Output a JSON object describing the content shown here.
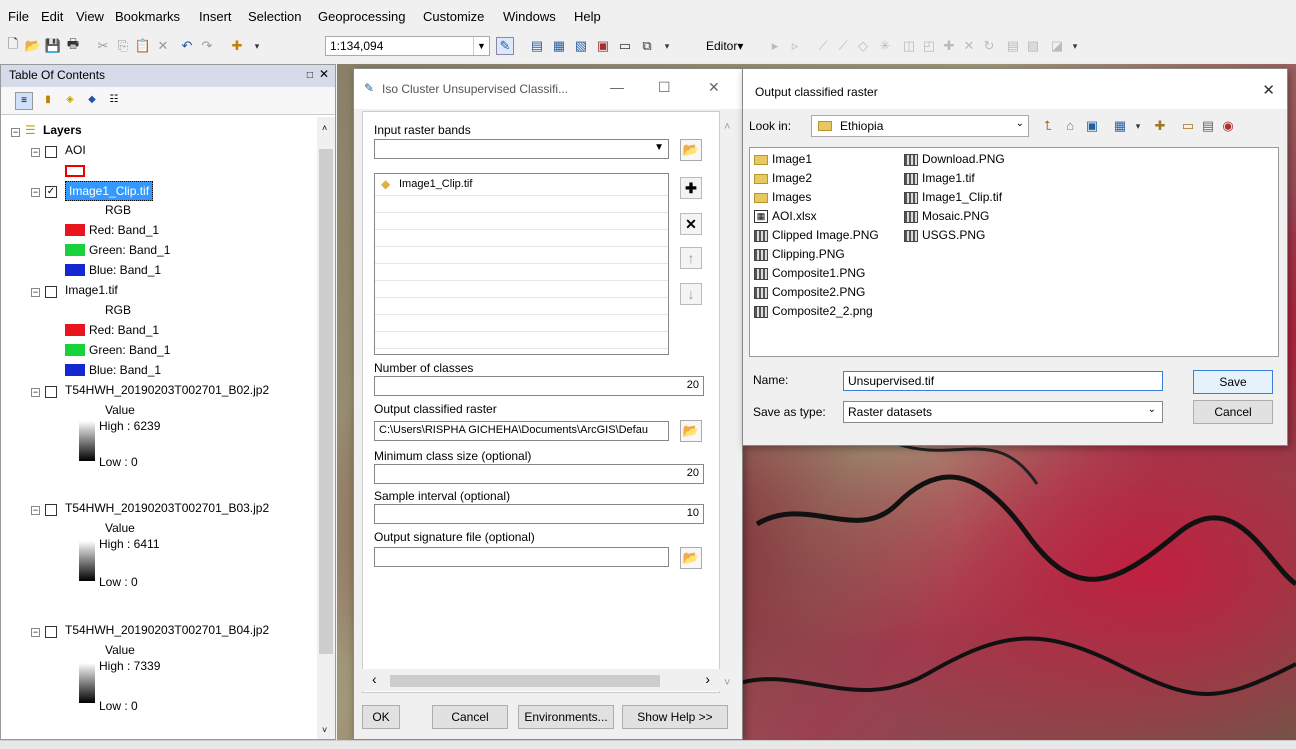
{
  "menu": [
    "File",
    "Edit",
    "View",
    "Bookmarks",
    "Insert",
    "Selection",
    "Geoprocessing",
    "Customize",
    "Windows",
    "Help"
  ],
  "toolbar": {
    "scale": "1:134,094",
    "editor_label": "Editor▾"
  },
  "toc": {
    "title": "Table Of Contents",
    "close": "✕",
    "items": [
      {
        "label": "Layers"
      },
      {
        "label": "AOI"
      },
      {
        "label": "Image1_Clip.tif"
      },
      {
        "label": "RGB"
      },
      {
        "label": "Red:   Band_1"
      },
      {
        "label": "Green: Band_1"
      },
      {
        "label": "Blue:  Band_1"
      },
      {
        "label": "Image1.tif"
      },
      {
        "label": "RGB"
      },
      {
        "label": "Red:   Band_1"
      },
      {
        "label": "Green: Band_1"
      },
      {
        "label": "Blue:  Band_1"
      },
      {
        "label": "T54HWH_20190203T002701_B02.jp2"
      },
      {
        "label": "Value"
      },
      {
        "label": "High : 6239"
      },
      {
        "label": "Low : 0"
      },
      {
        "label": "T54HWH_20190203T002701_B03.jp2"
      },
      {
        "label": "Value"
      },
      {
        "label": "High : 6411"
      },
      {
        "label": "Low : 0"
      },
      {
        "label": "T54HWH_20190203T002701_B04.jp2"
      },
      {
        "label": "Value"
      },
      {
        "label": "High : 7339"
      },
      {
        "label": "Low : 0"
      }
    ]
  },
  "iso": {
    "title": "Iso Cluster Unsupervised Classifi...",
    "input_bands_label": "Input raster bands",
    "band_item": "Image1_Clip.tif",
    "num_classes_label": "Number of classes",
    "num_classes_value": "20",
    "output_label": "Output classified raster",
    "output_value": "C:\\Users\\RISPHA GICHEHA\\Documents\\ArcGIS\\Defau",
    "min_class_label": "Minimum class size (optional)",
    "min_class_value": "20",
    "sample_label": "Sample interval (optional)",
    "sample_value": "10",
    "sig_label": "Output signature file (optional)",
    "ok": "OK",
    "cancel": "Cancel",
    "env": "Environments...",
    "help": "Show Help >>"
  },
  "file_dialog": {
    "title": "Output classified raster",
    "lookin_label": "Look in:",
    "lookin_value": "Ethiopia",
    "files_col1": [
      {
        "name": "Image1",
        "type": "folder"
      },
      {
        "name": "Image2",
        "type": "folder"
      },
      {
        "name": "Images",
        "type": "folder"
      },
      {
        "name": "AOI.xlsx",
        "type": "table"
      },
      {
        "name": "Clipped Image.PNG",
        "type": "raster"
      },
      {
        "name": "Clipping.PNG",
        "type": "raster"
      },
      {
        "name": "Composite1.PNG",
        "type": "raster"
      },
      {
        "name": "Composite2.PNG",
        "type": "raster"
      },
      {
        "name": "Composite2_2.png",
        "type": "raster"
      }
    ],
    "files_col2": [
      {
        "name": "Download.PNG",
        "type": "raster"
      },
      {
        "name": "Image1.tif",
        "type": "raster"
      },
      {
        "name": "Image1_Clip.tif",
        "type": "raster"
      },
      {
        "name": "Mosaic.PNG",
        "type": "raster"
      },
      {
        "name": "USGS.PNG",
        "type": "raster"
      }
    ],
    "name_label": "Name:",
    "name_value": "Unsupervised.tif",
    "type_label": "Save as type:",
    "type_value": "Raster datasets",
    "save": "Save",
    "cancel": "Cancel"
  },
  "colors": {
    "red": "#e8141e",
    "green": "#18d23c",
    "blue": "#1428d2",
    "selection": "#3399ff"
  }
}
